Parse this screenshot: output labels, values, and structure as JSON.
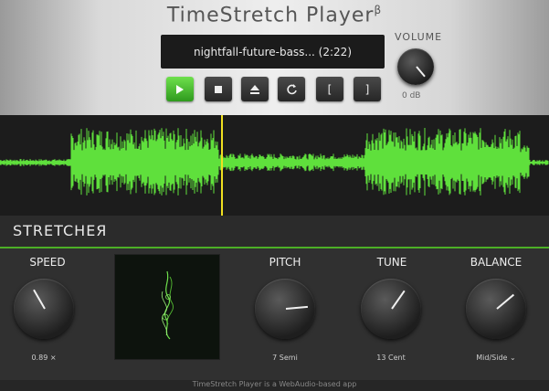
{
  "header": {
    "title": "TimeStretch Player",
    "beta": "β",
    "track_display": "nightfall-future-bass...  (2:22)"
  },
  "transport": {
    "play_icon": "play-icon",
    "stop_icon": "stop-icon",
    "eject_icon": "eject-icon",
    "loop_icon": "loop-icon",
    "loop_start_label": "[",
    "loop_end_label": "]"
  },
  "volume": {
    "label": "VOLUME",
    "value": "0 dB"
  },
  "stretcher": {
    "title": "STRETCHEЯ",
    "speed": {
      "label": "SPEED",
      "value": "0.89 ×"
    },
    "pitch": {
      "label": "PITCH",
      "value": "7 Semi"
    },
    "tune": {
      "label": "TUNE",
      "value": "13 Cent"
    },
    "balance": {
      "label": "BALANCE",
      "value": "Mid/Side ⌄"
    }
  },
  "colors": {
    "accent": "#5fe03c",
    "waveform": "#5fe03c",
    "playhead": "#f0e020"
  },
  "footer": {
    "text": "TimeStretch Player is a WebAudio-based app"
  }
}
